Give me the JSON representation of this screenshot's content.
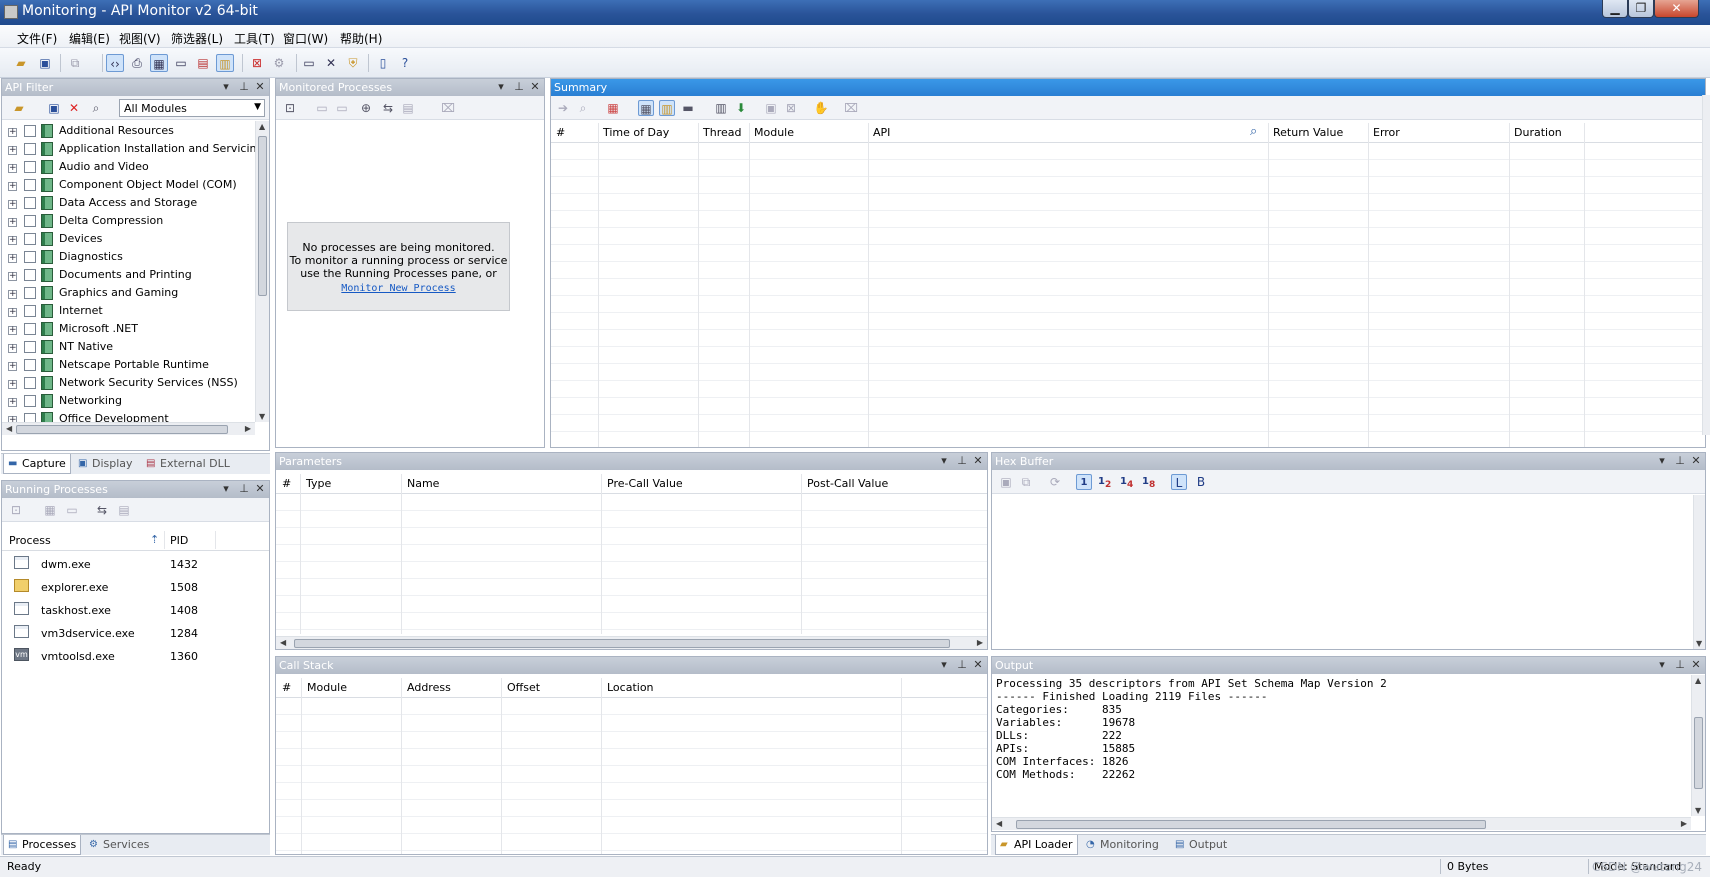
{
  "window": {
    "title": "Monitoring - API Monitor v2 64-bit",
    "minimize": "▁",
    "restore": "❐",
    "close": "✕"
  },
  "menu": [
    "文件(F)",
    "编辑(E)",
    "视图(V)",
    "筛选器(L)",
    "工具(T)",
    "窗口(W)",
    "帮助(H)"
  ],
  "api_filter": {
    "title": "API Filter",
    "module_select": "All Modules",
    "categories": [
      "Additional Resources",
      "Application Installation and Servicing",
      "Audio and Video",
      "Component Object Model (COM)",
      "Data Access and Storage",
      "Delta Compression",
      "Devices",
      "Diagnostics",
      "Documents and Printing",
      "Graphics and Gaming",
      "Internet",
      "Microsoft .NET",
      "NT Native",
      "Netscape Portable Runtime",
      "Network Security Services (NSS)",
      "Networking",
      "Office Development"
    ],
    "tabs": [
      "Capture",
      "Display",
      "External DLL"
    ]
  },
  "monitored": {
    "title": "Monitored Processes",
    "empty_line1": "No processes are being monitored.",
    "empty_line2": "To monitor a running process or service",
    "empty_line3": "use the Running Processes pane, or",
    "link": "Monitor New Process"
  },
  "summary": {
    "title": "Summary",
    "columns": [
      "#",
      "Time of Day",
      "Thread",
      "Module",
      "API",
      "Return Value",
      "Error",
      "Duration"
    ]
  },
  "running": {
    "title": "Running Processes",
    "columns": [
      "Process",
      "PID"
    ],
    "rows": [
      {
        "name": "dwm.exe",
        "pid": "1432",
        "icon": "window-app-icon"
      },
      {
        "name": "explorer.exe",
        "pid": "1508",
        "icon": "folder-app-icon"
      },
      {
        "name": "taskhost.exe",
        "pid": "1408",
        "icon": "window-app-icon"
      },
      {
        "name": "vm3dservice.exe",
        "pid": "1284",
        "icon": "window-app-icon"
      },
      {
        "name": "vmtoolsd.exe",
        "pid": "1360",
        "icon": "vm-icon"
      }
    ],
    "tabs": [
      "Processes",
      "Services"
    ]
  },
  "parameters": {
    "title": "Parameters",
    "columns": [
      "#",
      "Type",
      "Name",
      "Pre-Call Value",
      "Post-Call Value"
    ]
  },
  "hex": {
    "title": "Hex Buffer"
  },
  "callstack": {
    "title": "Call Stack",
    "columns": [
      "#",
      "Module",
      "Address",
      "Offset",
      "Location"
    ]
  },
  "output": {
    "title": "Output",
    "lines": [
      "Processing 35 descriptors from API Set Schema Map Version 2",
      "------ Finished Loading 2119 Files ------",
      "Categories:     835",
      "Variables:      19678",
      "DLLs:           222",
      "APIs:           15885",
      "COM Interfaces: 1826",
      "COM Methods:    22262"
    ],
    "tabs": [
      "API Loader",
      "Monitoring",
      "Output"
    ]
  },
  "status": {
    "left": "Ready",
    "bytes": "0 Bytes",
    "mode": "Mode: Standard",
    "watermark": "CSDN @wutong24"
  },
  "colors": {
    "active_header": "#2a7fd3",
    "inactive_header": "#b4bcc9",
    "titlebar": "#2a5499"
  }
}
